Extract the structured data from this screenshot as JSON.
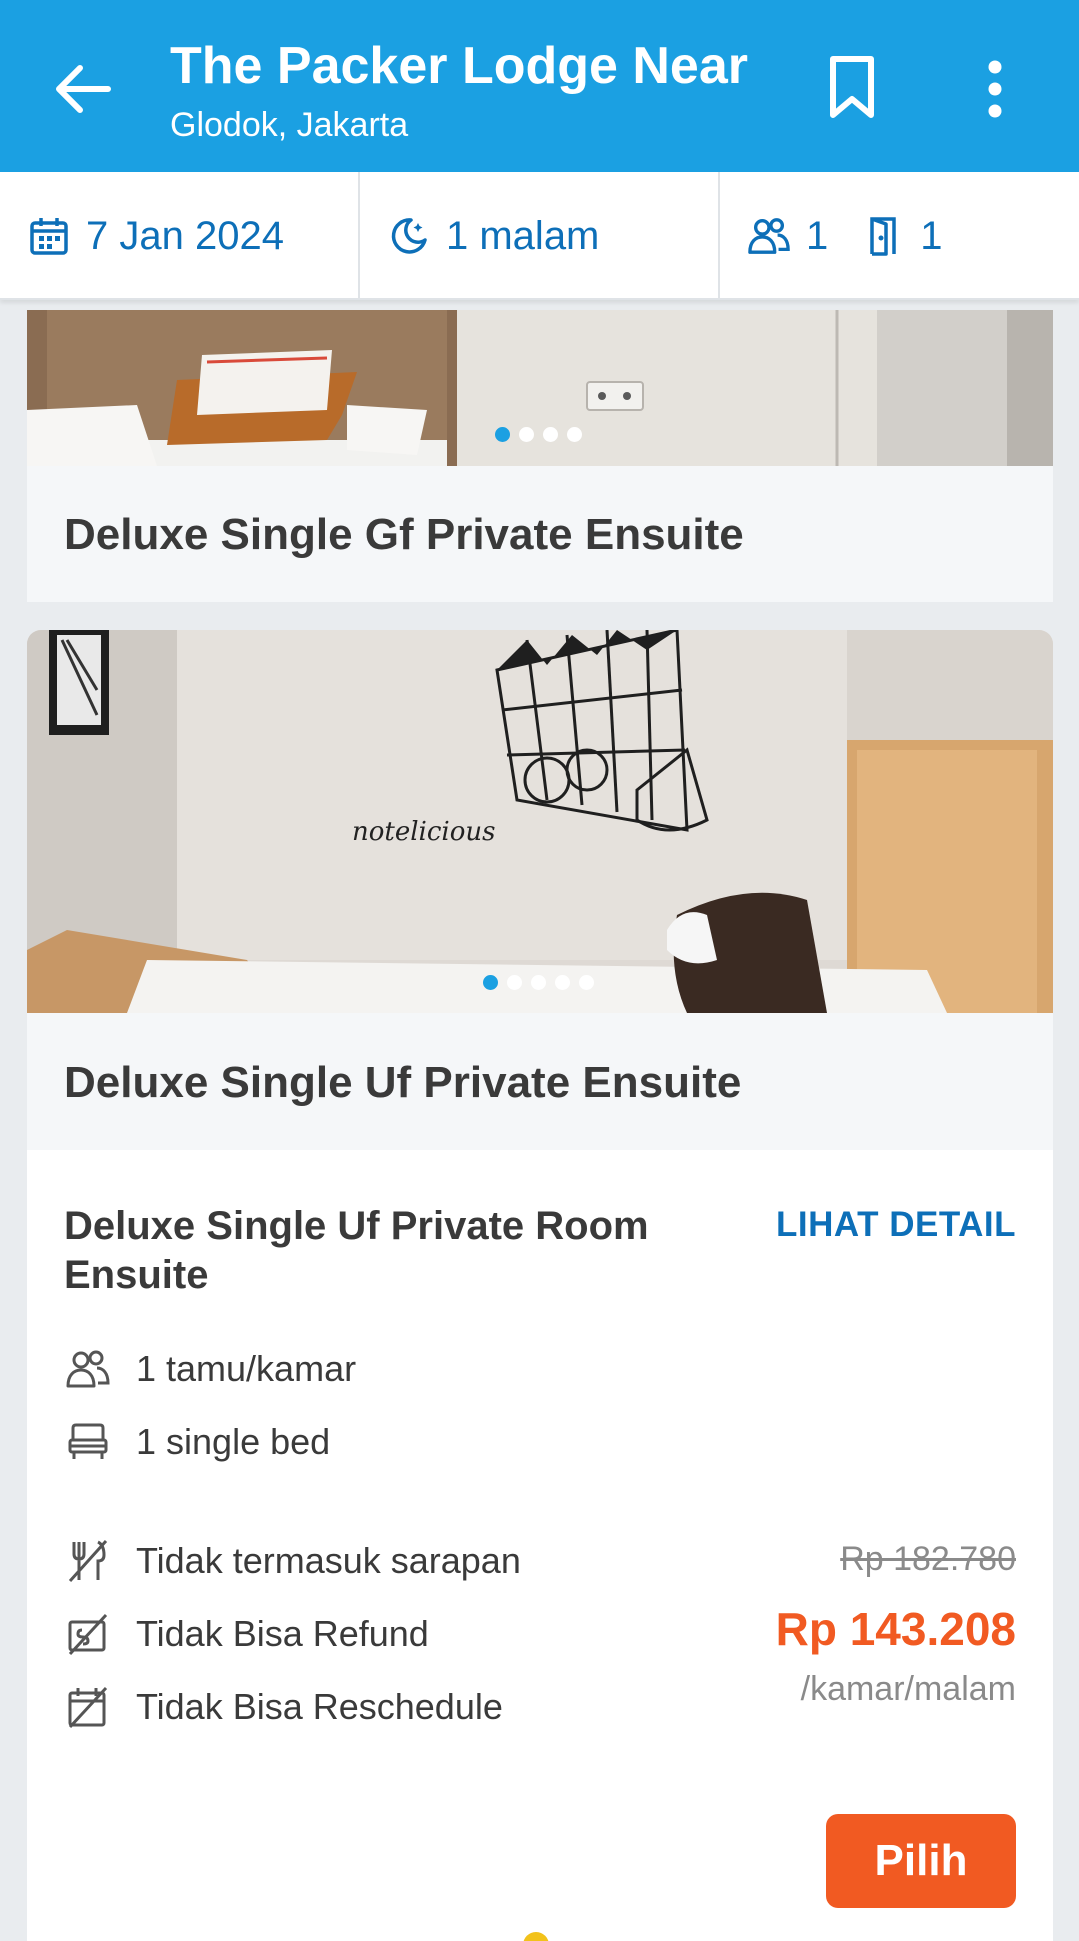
{
  "header": {
    "title": "The Packer Lodge Near",
    "subtitle": "Glodok, Jakarta",
    "colors": {
      "background": "#1ba0e2",
      "text": "#ffffff"
    }
  },
  "search": {
    "date": "7 Jan 2024",
    "nights": "1 malam",
    "guests": "1",
    "rooms": "1"
  },
  "rooms": [
    {
      "name": "Deluxe Single Gf Private Ensuite",
      "photo_count": 4,
      "active_photo": 1
    },
    {
      "name": "Deluxe Single Uf Private Ensuite",
      "photo_count": 5,
      "active_photo": 1,
      "photo_caption": "notelicious",
      "rate": {
        "name": "Deluxe Single Uf Private Room Ensuite",
        "detail_label": "LIHAT DETAIL",
        "guests": "1 tamu/kamar",
        "bed": "1 single bed",
        "breakfast": "Tidak termasuk sarapan",
        "refund": "Tidak Bisa Refund",
        "reschedule": "Tidak Bisa Reschedule",
        "original_price": "Rp 182.780",
        "price": "Rp 143.208",
        "price_unit": "/kamar/malam",
        "select_label": "Pilih"
      }
    }
  ],
  "colors": {
    "accent": "#0d6fb8",
    "price": "#f15a22",
    "cta": "#f15a22"
  }
}
